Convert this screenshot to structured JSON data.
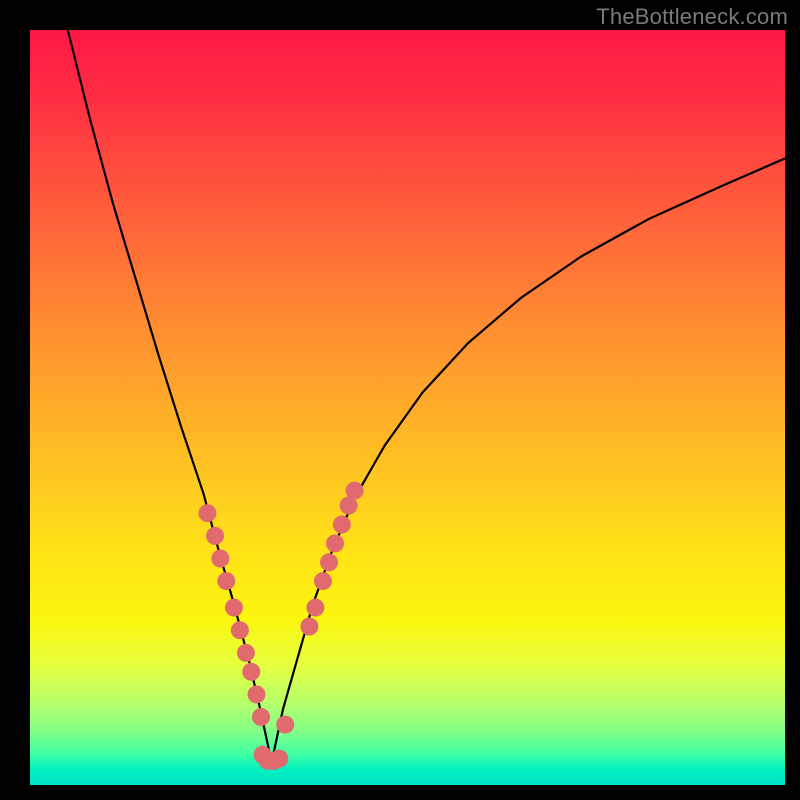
{
  "watermark": "TheBottleneck.com",
  "chart_data": {
    "type": "line",
    "title": "",
    "xlabel": "",
    "ylabel": "",
    "xlim": [
      0,
      100
    ],
    "ylim": [
      0,
      100
    ],
    "background": "gradient-red-yellow-green",
    "series": [
      {
        "name": "bottleneck-curve",
        "description": "V-shaped curve: steep descent from top-left to valley near x≈32, then rise toward right edge.",
        "note": "Values estimated from pixel positions; axes unlabeled in source image.",
        "x": [
          5,
          8,
          11,
          14,
          17,
          20,
          23,
          25,
          27,
          29,
          30.5,
          32,
          33.5,
          35.5,
          37.5,
          40,
          43,
          47,
          52,
          58,
          65,
          73,
          82,
          92,
          100
        ],
        "y": [
          100,
          88,
          77,
          67,
          57,
          47.5,
          38.5,
          31,
          24,
          16.5,
          10,
          3,
          10,
          17,
          24,
          31,
          38,
          45,
          52,
          58.5,
          64.5,
          70,
          75,
          79.5,
          83
        ]
      }
    ],
    "markers": {
      "name": "highlighted-points",
      "color": "#e06a6d",
      "radius_px": 9,
      "points": [
        {
          "x": 23.5,
          "y": 36
        },
        {
          "x": 24.5,
          "y": 33
        },
        {
          "x": 25.2,
          "y": 30
        },
        {
          "x": 26.0,
          "y": 27
        },
        {
          "x": 27.0,
          "y": 23.5
        },
        {
          "x": 27.8,
          "y": 20.5
        },
        {
          "x": 28.6,
          "y": 17.5
        },
        {
          "x": 29.3,
          "y": 15
        },
        {
          "x": 30.0,
          "y": 12
        },
        {
          "x": 30.6,
          "y": 9
        },
        {
          "x": 30.8,
          "y": 4
        },
        {
          "x": 31.5,
          "y": 3.2
        },
        {
          "x": 32.3,
          "y": 3.2
        },
        {
          "x": 33.0,
          "y": 3.5
        },
        {
          "x": 33.8,
          "y": 8
        },
        {
          "x": 37.0,
          "y": 21
        },
        {
          "x": 37.8,
          "y": 23.5
        },
        {
          "x": 38.8,
          "y": 27
        },
        {
          "x": 39.6,
          "y": 29.5
        },
        {
          "x": 40.4,
          "y": 32
        },
        {
          "x": 41.3,
          "y": 34.5
        },
        {
          "x": 42.2,
          "y": 37
        },
        {
          "x": 43.0,
          "y": 39
        }
      ]
    }
  }
}
